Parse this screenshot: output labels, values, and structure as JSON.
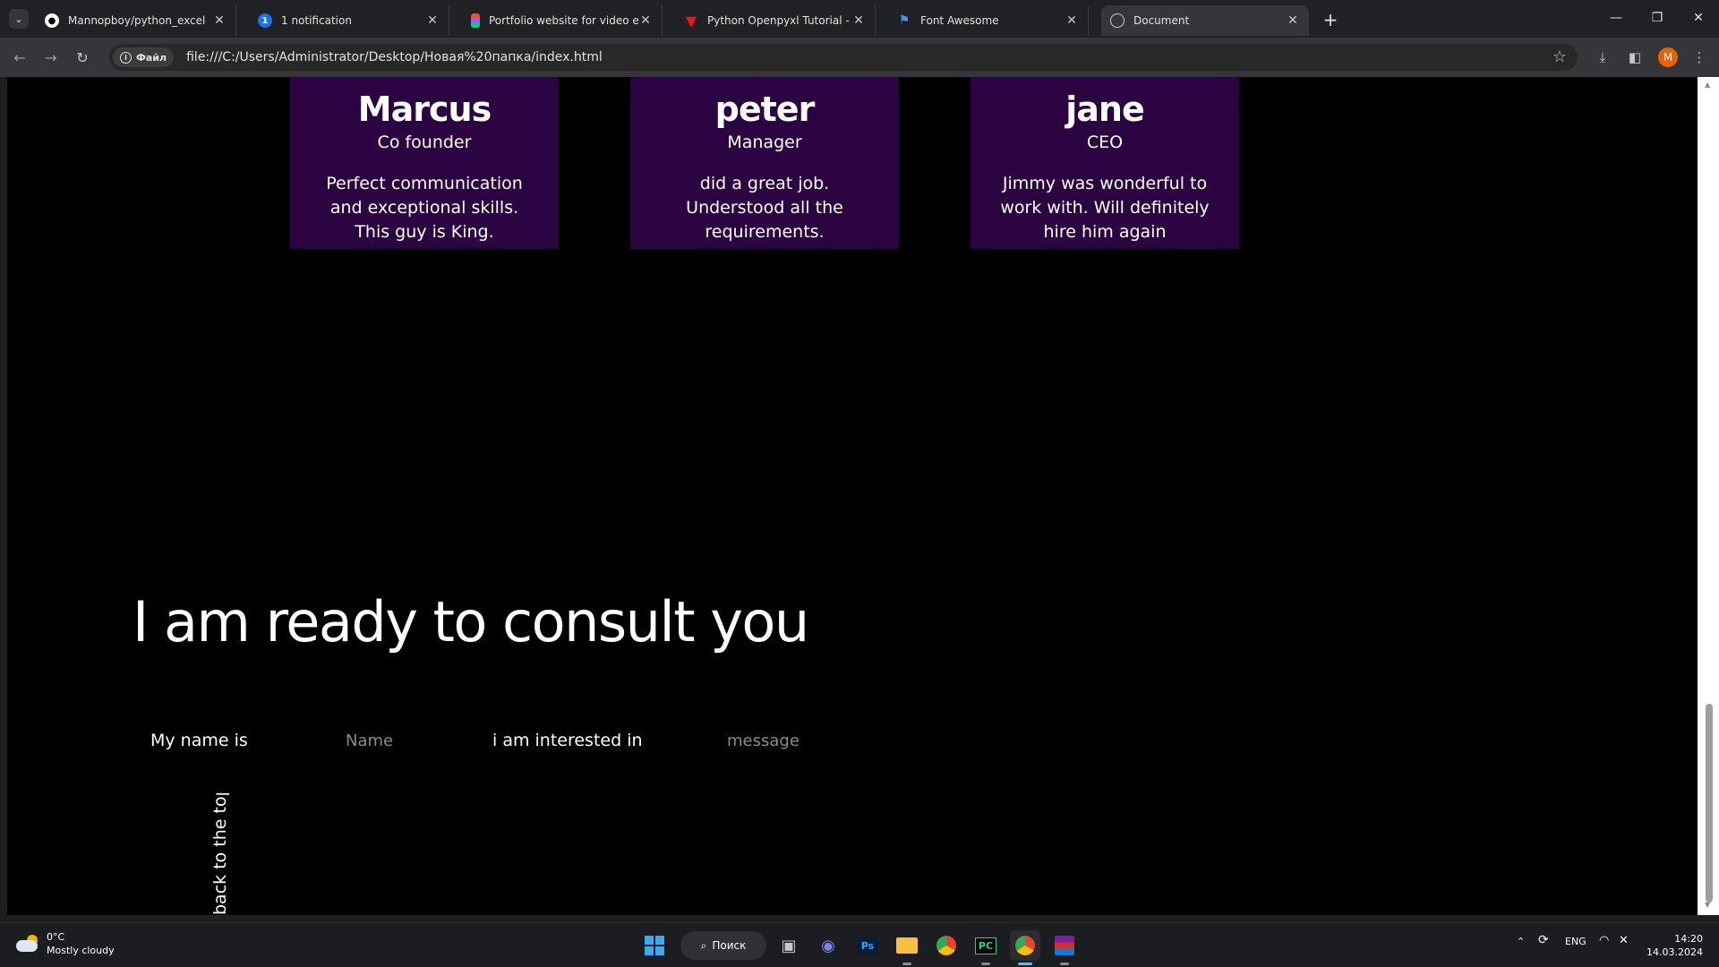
{
  "browser": {
    "tabs": [
      {
        "title": "Mannopboy/python_excel",
        "favicon": "github-icon"
      },
      {
        "title": "1 notification",
        "favicon": "notification-badge-icon",
        "badge": "1"
      },
      {
        "title": "Portfolio website for video edito",
        "favicon": "figma-icon"
      },
      {
        "title": "Python Openpyxl Tutorial - java",
        "favicon": "javatpoint-icon"
      },
      {
        "title": "Font Awesome",
        "favicon": "flag-icon"
      },
      {
        "title": "Document",
        "favicon": "globe-icon",
        "active": true
      }
    ],
    "address": {
      "chip_label": "Файл",
      "url": "file:///C:/Users/Administrator/Desktop/Новая%20папка/index.html"
    },
    "profile_initial": "M"
  },
  "page": {
    "testimonials": [
      {
        "name": "Marcus",
        "role": "Co founder",
        "quote": "Perfect communication and exceptional skills. This guy is King."
      },
      {
        "name": "peter",
        "role": "Manager",
        "quote": "did a great job. Understood all the requirements."
      },
      {
        "name": "jane",
        "role": "CEO",
        "quote": "Jimmy was wonderful to work with. Will definitely hire him again"
      }
    ],
    "consult_heading": "I am ready to consult you",
    "form": {
      "name_label": "My name is",
      "name_placeholder": "Name",
      "interest_label": "i am interested in",
      "message_placeholder": "message"
    },
    "back_to_top": "back to the top",
    "card_color": "#2a0340"
  },
  "taskbar": {
    "weather": {
      "temp": "0°C",
      "desc": "Mostly cloudy"
    },
    "search_label": "Поиск",
    "apps": [
      "windows-start-icon",
      "task-view-icon",
      "teams-chat-icon",
      "photoshop-icon",
      "file-explorer-icon",
      "chrome-icon",
      "pycharm-icon",
      "chrome-profile-icon",
      "winrar-icon"
    ],
    "photoshop_label": "Ps",
    "pycharm_label": "PC",
    "language": "ENG",
    "time": "14:20",
    "date": "14.03.2024"
  }
}
